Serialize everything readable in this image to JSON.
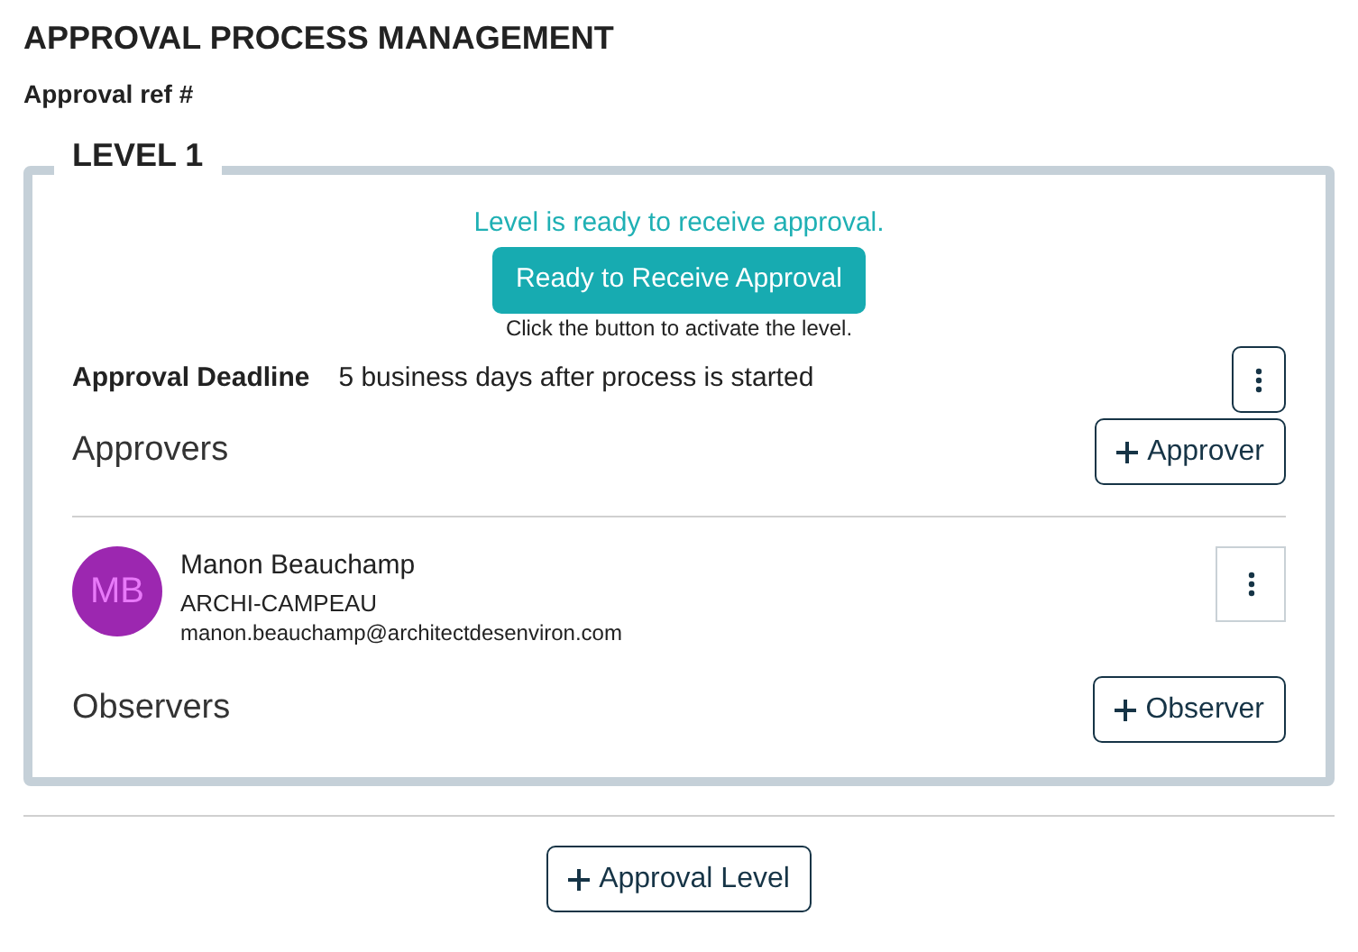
{
  "title": "APPROVAL PROCESS MANAGEMENT",
  "ref_label": "Approval ref #",
  "level": {
    "legend": "LEVEL 1",
    "status": "Level is ready to receive approval.",
    "activate_button": "Ready to Receive Approval",
    "hint": "Click the button to activate the level.",
    "deadline_label": "Approval Deadline",
    "deadline_value": "5 business days after process is started",
    "approvers_heading": "Approvers",
    "add_approver": "Approver",
    "approvers": [
      {
        "initials": "MB",
        "name": "Manon Beauchamp",
        "company": "ARCHI-CAMPEAU",
        "email": "manon.beauchamp@architectdesenviron.com"
      }
    ],
    "observers_heading": "Observers",
    "add_observer": "Observer"
  },
  "add_level": "Approval Level"
}
